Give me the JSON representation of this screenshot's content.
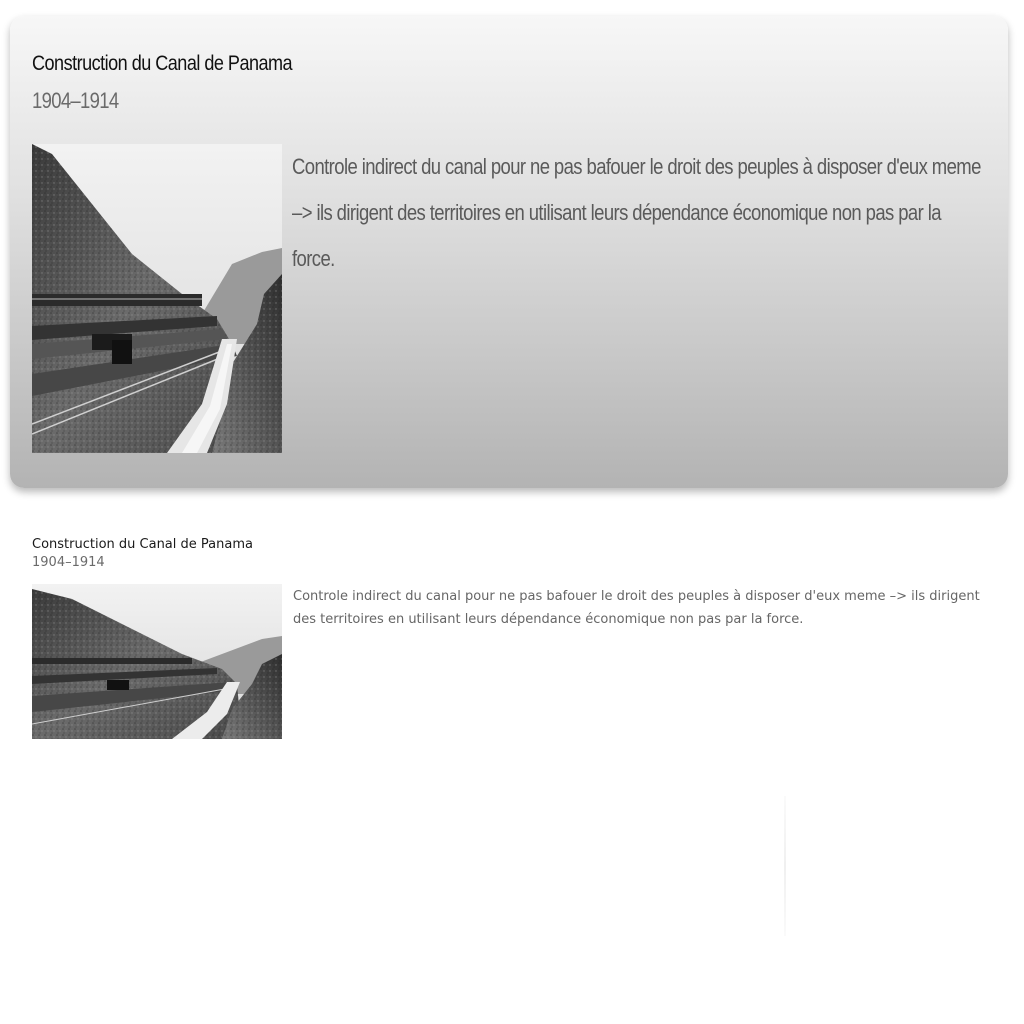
{
  "card": {
    "title": "Construction du Canal de Panama",
    "dates": "1904–1914",
    "description": "Controle indirect du canal pour ne pas bafouer le droit des peuples à disposer d'eux meme –> ils dirigent des territoires en utilisant leurs dépendance économique non pas par la force.",
    "image_label": "Panama Canal construction photograph"
  },
  "preview": {
    "title": "Construction du Canal de Panama",
    "dates": "1904–1914",
    "description": "Controle indirect du canal pour ne pas bafouer le droit des peuples à disposer d'eux meme –> ils dirigent des territoires en utilisant leurs dépendance économique non pas par la force.",
    "image_label": "Panama Canal construction photograph"
  },
  "colors": {
    "card_top": "#f7f7f7",
    "card_bottom": "#b3b3b3",
    "title": "#111111",
    "muted_text": "#6a6a6a"
  }
}
